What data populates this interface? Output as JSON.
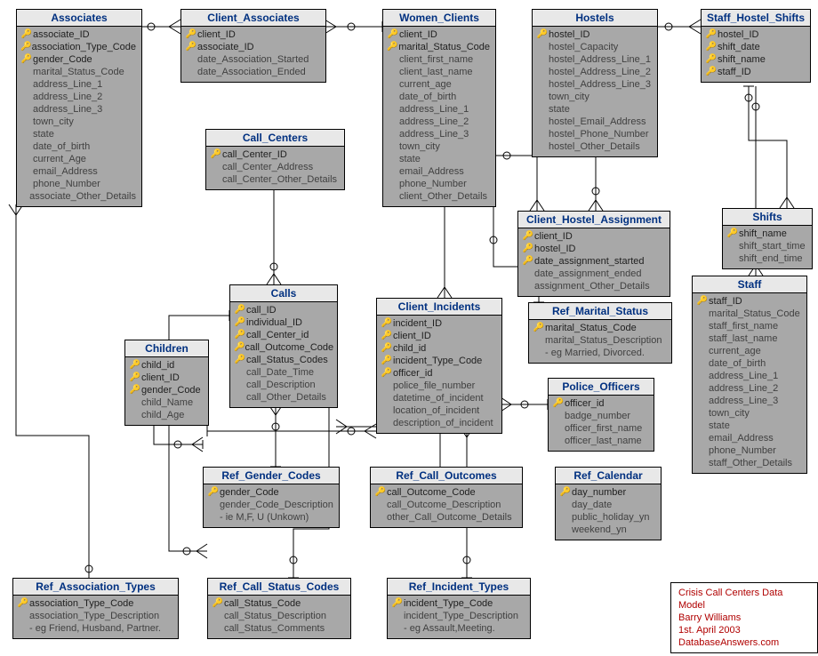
{
  "entities": {
    "associates": {
      "title": "Associates",
      "cols": [
        {
          "k": "pk",
          "n": "associate_ID"
        },
        {
          "k": "fk",
          "n": "association_Type_Code"
        },
        {
          "k": "fk",
          "n": "gender_Code"
        },
        {
          "k": "",
          "n": "marital_Status_Code"
        },
        {
          "k": "",
          "n": "address_Line_1"
        },
        {
          "k": "",
          "n": "address_Line_2"
        },
        {
          "k": "",
          "n": "address_Line_3"
        },
        {
          "k": "",
          "n": "town_city"
        },
        {
          "k": "",
          "n": "state"
        },
        {
          "k": "",
          "n": "date_of_birth"
        },
        {
          "k": "",
          "n": "current_Age"
        },
        {
          "k": "",
          "n": "email_Address"
        },
        {
          "k": "",
          "n": "phone_Number"
        },
        {
          "k": "",
          "n": "associate_Other_Details"
        }
      ]
    },
    "client_associates": {
      "title": "Client_Associates",
      "cols": [
        {
          "k": "pf",
          "n": "client_ID"
        },
        {
          "k": "pf",
          "n": "associate_ID"
        },
        {
          "k": "",
          "n": "date_Association_Started"
        },
        {
          "k": "",
          "n": "date_Association_Ended"
        }
      ]
    },
    "women_clients": {
      "title": "Women_Clients",
      "cols": [
        {
          "k": "pk",
          "n": "client_ID"
        },
        {
          "k": "fk",
          "n": "marital_Status_Code"
        },
        {
          "k": "",
          "n": "client_first_name"
        },
        {
          "k": "",
          "n": "client_last_name"
        },
        {
          "k": "",
          "n": "current_age"
        },
        {
          "k": "",
          "n": "date_of_birth"
        },
        {
          "k": "",
          "n": "address_Line_1"
        },
        {
          "k": "",
          "n": "address_Line_2"
        },
        {
          "k": "",
          "n": "address_Line_3"
        },
        {
          "k": "",
          "n": "town_city"
        },
        {
          "k": "",
          "n": "state"
        },
        {
          "k": "",
          "n": "email_Address"
        },
        {
          "k": "",
          "n": "phone_Number"
        },
        {
          "k": "",
          "n": "client_Other_Details"
        }
      ]
    },
    "hostels": {
      "title": "Hostels",
      "cols": [
        {
          "k": "pk",
          "n": "hostel_ID"
        },
        {
          "k": "",
          "n": "hostel_Capacity"
        },
        {
          "k": "",
          "n": "hostel_Address_Line_1"
        },
        {
          "k": "",
          "n": "hostel_Address_Line_2"
        },
        {
          "k": "",
          "n": "hostel_Address_Line_3"
        },
        {
          "k": "",
          "n": "town_city"
        },
        {
          "k": "",
          "n": "state"
        },
        {
          "k": "",
          "n": "hostel_Email_Address"
        },
        {
          "k": "",
          "n": "hostel_Phone_Number"
        },
        {
          "k": "",
          "n": "hostel_Other_Details"
        }
      ]
    },
    "staff_hostel_shifts": {
      "title": "Staff_Hostel_Shifts",
      "cols": [
        {
          "k": "fk",
          "n": "hostel_ID"
        },
        {
          "k": "fk",
          "n": "shift_date"
        },
        {
          "k": "fk",
          "n": "shift_name"
        },
        {
          "k": "fk",
          "n": "staff_ID"
        }
      ]
    },
    "call_centers": {
      "title": "Call_Centers",
      "cols": [
        {
          "k": "pk",
          "n": "call_Center_ID"
        },
        {
          "k": "",
          "n": "call_Center_Address"
        },
        {
          "k": "",
          "n": "call_Center_Other_Details"
        }
      ]
    },
    "client_hostel_assignment": {
      "title": "Client_Hostel_Assignment",
      "cols": [
        {
          "k": "pf",
          "n": "client_ID"
        },
        {
          "k": "pf",
          "n": "hostel_ID"
        },
        {
          "k": "pk",
          "n": "date_assignment_started"
        },
        {
          "k": "",
          "n": "date_assignment_ended"
        },
        {
          "k": "",
          "n": "assignment_Other_Details"
        }
      ]
    },
    "shifts": {
      "title": "Shifts",
      "cols": [
        {
          "k": "pk",
          "n": "shift_name"
        },
        {
          "k": "",
          "n": "shift_start_time"
        },
        {
          "k": "",
          "n": "shift_end_time"
        }
      ]
    },
    "calls": {
      "title": "Calls",
      "cols": [
        {
          "k": "pk",
          "n": "call_ID"
        },
        {
          "k": "fk",
          "n": "individual_ID"
        },
        {
          "k": "fk",
          "n": "call_Center_id"
        },
        {
          "k": "fk",
          "n": "call_Outcome_Code"
        },
        {
          "k": "fk",
          "n": "call_Status_Codes"
        },
        {
          "k": "",
          "n": "call_Date_Time"
        },
        {
          "k": "",
          "n": "call_Description"
        },
        {
          "k": "",
          "n": "call_Other_Details"
        }
      ]
    },
    "client_incidents": {
      "title": "Client_Incidents",
      "cols": [
        {
          "k": "pk",
          "n": "incident_ID"
        },
        {
          "k": "fk",
          "n": "client_ID"
        },
        {
          "k": "fk",
          "n": "child_id"
        },
        {
          "k": "fk",
          "n": "incident_Type_Code"
        },
        {
          "k": "fk",
          "n": "officer_id"
        },
        {
          "k": "",
          "n": "police_file_number"
        },
        {
          "k": "",
          "n": "datetime_of_incident"
        },
        {
          "k": "",
          "n": "location_of_incident"
        },
        {
          "k": "",
          "n": "description_of_incident"
        }
      ]
    },
    "ref_marital_status": {
      "title": "Ref_Marital_Status",
      "cols": [
        {
          "k": "pk",
          "n": "marital_Status_Code"
        },
        {
          "k": "",
          "n": "marital_Status_Description"
        },
        {
          "k": "",
          "n": "- eg Married, Divorced."
        }
      ]
    },
    "staff": {
      "title": "Staff",
      "cols": [
        {
          "k": "pk",
          "n": "staff_ID"
        },
        {
          "k": "",
          "n": "marital_Status_Code"
        },
        {
          "k": "",
          "n": "staff_first_name"
        },
        {
          "k": "",
          "n": "staff_last_name"
        },
        {
          "k": "",
          "n": "current_age"
        },
        {
          "k": "",
          "n": "date_of_birth"
        },
        {
          "k": "",
          "n": "address_Line_1"
        },
        {
          "k": "",
          "n": "address_Line_2"
        },
        {
          "k": "",
          "n": "address_Line_3"
        },
        {
          "k": "",
          "n": "town_city"
        },
        {
          "k": "",
          "n": "state"
        },
        {
          "k": "",
          "n": "email_Address"
        },
        {
          "k": "",
          "n": "phone_Number"
        },
        {
          "k": "",
          "n": "staff_Other_Details"
        }
      ]
    },
    "children": {
      "title": "Children",
      "cols": [
        {
          "k": "pk",
          "n": "child_id"
        },
        {
          "k": "fk",
          "n": "client_ID"
        },
        {
          "k": "fk",
          "n": "gender_Code"
        },
        {
          "k": "",
          "n": "child_Name"
        },
        {
          "k": "",
          "n": "child_Age"
        }
      ]
    },
    "police_officers": {
      "title": "Police_Officers",
      "cols": [
        {
          "k": "pk",
          "n": "officer_id"
        },
        {
          "k": "",
          "n": "badge_number"
        },
        {
          "k": "",
          "n": "officer_first_name"
        },
        {
          "k": "",
          "n": "officer_last_name"
        }
      ]
    },
    "ref_calendar": {
      "title": "Ref_Calendar",
      "cols": [
        {
          "k": "pk",
          "n": "day_number"
        },
        {
          "k": "",
          "n": "day_date"
        },
        {
          "k": "",
          "n": "public_holiday_yn"
        },
        {
          "k": "",
          "n": "weekend_yn"
        }
      ]
    },
    "ref_gender_codes": {
      "title": "Ref_Gender_Codes",
      "cols": [
        {
          "k": "pk",
          "n": "gender_Code"
        },
        {
          "k": "",
          "n": "gender_Code_Description"
        },
        {
          "k": "",
          "n": "- ie M,F, U (Unkown)"
        }
      ]
    },
    "ref_call_outcomes": {
      "title": "Ref_Call_Outcomes",
      "cols": [
        {
          "k": "pk",
          "n": "call_Outcome_Code"
        },
        {
          "k": "",
          "n": "call_Outcome_Description"
        },
        {
          "k": "",
          "n": "other_Call_Outcome_Details"
        }
      ]
    },
    "ref_association_types": {
      "title": "Ref_Association_Types",
      "cols": [
        {
          "k": "pk",
          "n": "association_Type_Code"
        },
        {
          "k": "",
          "n": "association_Type_Description"
        },
        {
          "k": "",
          "n": "- eg Friend, Husband, Partner."
        }
      ]
    },
    "ref_call_status_codes": {
      "title": "Ref_Call_Status_Codes",
      "cols": [
        {
          "k": "pk",
          "n": "call_Status_Code"
        },
        {
          "k": "",
          "n": "call_Status_Description"
        },
        {
          "k": "",
          "n": "call_Status_Comments"
        }
      ]
    },
    "ref_incident_types": {
      "title": "Ref_Incident_Types",
      "cols": [
        {
          "k": "pk",
          "n": "incident_Type_Code"
        },
        {
          "k": "",
          "n": "incident_Type_Description"
        },
        {
          "k": "",
          "n": "- eg Assault,Meeting."
        }
      ]
    }
  },
  "footer": {
    "line1": "Crisis Call Centers Data Model",
    "line2": "Barry Williams",
    "line3": "1st. April 2003",
    "line4": "DatabaseAnswers.com"
  }
}
